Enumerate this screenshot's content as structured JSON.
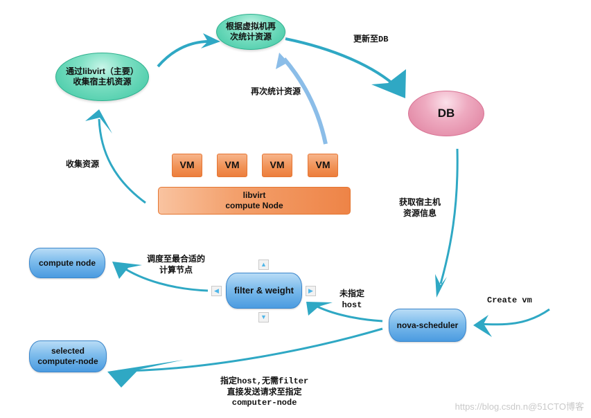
{
  "nodes": {
    "collect_libvirt": {
      "line1": "通过libvirt（主要）",
      "line2": "收集宿主机资源"
    },
    "recount": {
      "line1": "根据虚拟机再",
      "line2": "次统计资源"
    },
    "db": {
      "label": "DB"
    },
    "vms": [
      "VM",
      "VM",
      "VM",
      "VM"
    ],
    "compute_node_bar": {
      "line1": "libvirt",
      "line2": "compute Node"
    },
    "compute_node": {
      "label": "compute node"
    },
    "filter_weight": {
      "label": "filter &  weight"
    },
    "nova_scheduler": {
      "label": "nova-scheduler"
    },
    "selected_node": {
      "line1": "selected",
      "line2": "computer-node"
    }
  },
  "edge_labels": {
    "update_db": "更新至DB",
    "recount_resources": "再次统计资源",
    "collect_resources": "收集资源",
    "get_host_info": {
      "line1": "获取宿主机",
      "line2": "资源信息"
    },
    "schedule_best": {
      "line1": "调度至最合适的",
      "line2": "计算节点"
    },
    "no_host": {
      "line1": "未指定",
      "line2": "host"
    },
    "create_vm": "Create vm",
    "host_specified": {
      "line1": "指定host,无需filter",
      "line2": "直接发送请求至指定",
      "line3": "computer-node"
    }
  },
  "nav_buttons": {
    "up": "▲",
    "down": "▼",
    "left": "◀",
    "right": "▶"
  },
  "watermark": "https://blog.csdn.n@51CTO博客",
  "colors": {
    "arrow": "#2fa8c4",
    "arrow_light": "#8bbde8",
    "green_node": "#3cc6a2",
    "pink_node": "#de7d9c",
    "orange_node": "#f19358",
    "blue_node": "#4b9be0"
  }
}
